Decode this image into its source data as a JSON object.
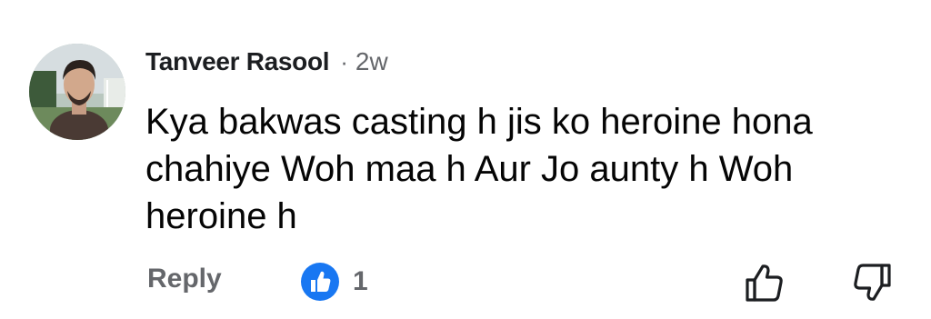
{
  "comment": {
    "author": "Tanveer Rasool",
    "separator": "·",
    "time": "2w",
    "text": "Kya bakwas casting h jis ko heroine hona chahiye Woh maa h Aur Jo aunty h Woh heroine h",
    "reply_label": "Reply",
    "reaction_count": "1",
    "reaction_icon": "like-icon",
    "colors": {
      "like_blue": "#1877f2",
      "secondary_text": "#65676b",
      "primary_text": "#050505"
    }
  }
}
